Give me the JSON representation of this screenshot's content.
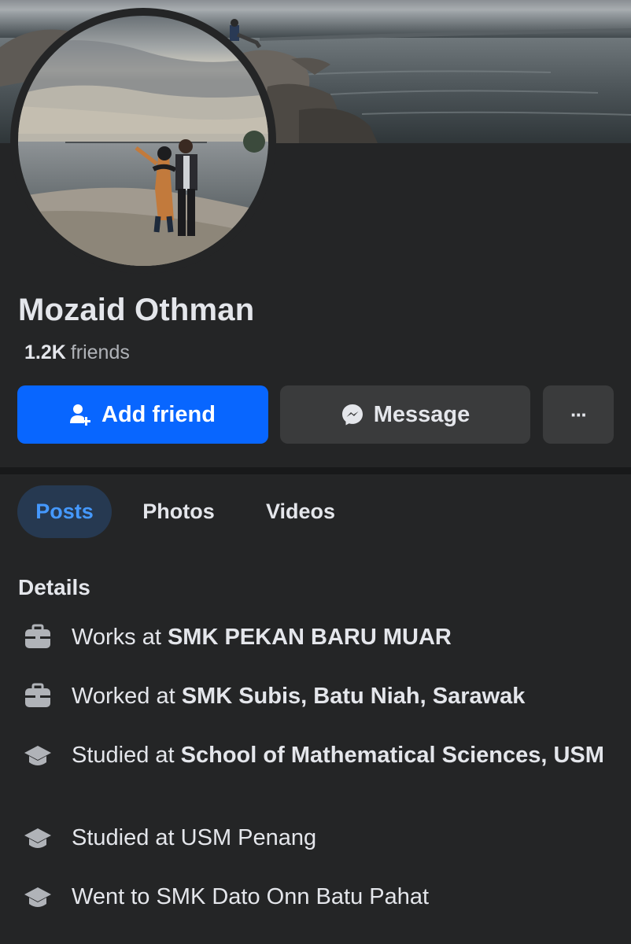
{
  "profile": {
    "name": "Mozaid Othman",
    "friends_count": "1.2K",
    "friends_label": "friends"
  },
  "actions": {
    "add_friend": "Add friend",
    "message": "Message",
    "more": "···"
  },
  "tabs": [
    {
      "label": "Posts",
      "active": true
    },
    {
      "label": "Photos",
      "active": false
    },
    {
      "label": "Videos",
      "active": false
    }
  ],
  "details": {
    "title": "Details",
    "items": [
      {
        "icon": "briefcase-icon",
        "prefix": "Works at ",
        "value": "SMK PEKAN BARU MUAR"
      },
      {
        "icon": "briefcase-icon",
        "prefix": "Worked at ",
        "value": "SMK Subis, Batu Niah, Sarawak"
      },
      {
        "icon": "graduation-cap-icon",
        "prefix": "Studied at ",
        "value": "School of Mathematical Sciences, USM"
      },
      {
        "icon": "graduation-cap-icon",
        "prefix": "Studied at USM Penang",
        "value": ""
      },
      {
        "icon": "graduation-cap-icon",
        "prefix": "Went to SMK Dato Onn Batu Pahat",
        "value": ""
      }
    ]
  },
  "colors": {
    "background": "#242526",
    "primary_button": "#0866ff",
    "secondary_button": "#3a3b3c",
    "active_tab_bg": "#263951",
    "active_tab_text": "#4599ff",
    "text_primary": "#e4e6eb",
    "text_secondary": "#b0b3b8"
  }
}
